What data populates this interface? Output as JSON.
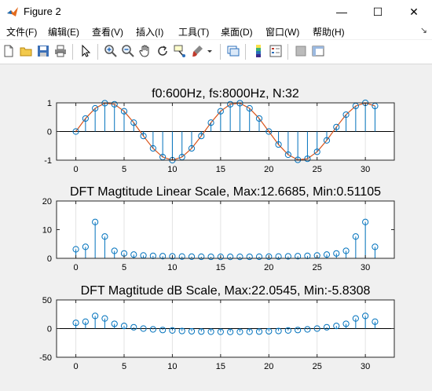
{
  "window": {
    "title": "Figure 2",
    "minimize_glyph": "—",
    "maximize_glyph": "☐",
    "close_glyph": "✕"
  },
  "menu": {
    "items": [
      "文件(F)",
      "编辑(E)",
      "查看(V)",
      "插入(I)",
      "工具(T)",
      "桌面(D)",
      "窗口(W)",
      "帮助(H)"
    ],
    "overflow_glyph": "↘"
  },
  "toolbar": {
    "icons": [
      "new-figure-icon",
      "open-file-icon",
      "save-icon",
      "print-icon",
      "pointer-icon",
      "zoom-in-icon",
      "zoom-out-icon",
      "pan-icon",
      "rotate-3d-icon",
      "data-cursor-icon",
      "brush-icon",
      "link-plot-icon",
      "colorbar-icon",
      "legend-icon",
      "hide-plot-tools-icon",
      "show-plot-tools-icon"
    ]
  },
  "colors": {
    "stem": "#0072BD",
    "line": "#D95319",
    "axes_bg": "#ffffff",
    "figure_bg": "#f0f0f0"
  },
  "chart_data": [
    {
      "type": "stem",
      "title": "f0:600Hz, fs:8000Hz, N:32",
      "xlim": [
        -2,
        33
      ],
      "ylim": [
        -1,
        1
      ],
      "xticks": [
        0,
        5,
        10,
        15,
        20,
        25,
        30
      ],
      "yticks": [
        -1,
        0,
        1
      ],
      "grid": "x",
      "zero_line": true,
      "x": [
        0,
        1,
        2,
        3,
        4,
        5,
        6,
        7,
        8,
        9,
        10,
        11,
        12,
        13,
        14,
        15,
        16,
        17,
        18,
        19,
        20,
        21,
        22,
        23,
        24,
        25,
        26,
        27,
        28,
        29,
        30,
        31
      ],
      "series": [
        {
          "kind": "stem",
          "color": "#0072BD",
          "values": [
            0,
            0.454,
            0.809,
            0.988,
            0.951,
            0.707,
            0.309,
            -0.156,
            -0.588,
            -0.891,
            -1.0,
            -0.891,
            -0.588,
            -0.156,
            0.309,
            0.707,
            0.951,
            0.988,
            0.809,
            0.454,
            0,
            -0.454,
            -0.809,
            -0.988,
            -0.951,
            -0.707,
            -0.309,
            0.156,
            0.588,
            0.891,
            1.0,
            0.891
          ]
        },
        {
          "kind": "line",
          "color": "#D95319",
          "values": [
            0,
            0.454,
            0.809,
            0.988,
            0.951,
            0.707,
            0.309,
            -0.156,
            -0.588,
            -0.891,
            -1.0,
            -0.891,
            -0.588,
            -0.156,
            0.309,
            0.707,
            0.951,
            0.988,
            0.809,
            0.454,
            0,
            -0.454,
            -0.809,
            -0.988,
            -0.951,
            -0.707,
            -0.309,
            0.156,
            0.588,
            0.891,
            1.0,
            0.891
          ]
        }
      ]
    },
    {
      "type": "stem",
      "title": "DFT Magtitude Linear Scale,  Max:12.6685, Min:0.51105",
      "xlim": [
        -2,
        33
      ],
      "ylim": [
        0,
        20
      ],
      "xticks": [
        0,
        5,
        10,
        15,
        20,
        25,
        30
      ],
      "yticks": [
        0,
        10,
        20
      ],
      "grid": "x",
      "zero_line": false,
      "x": [
        0,
        1,
        2,
        3,
        4,
        5,
        6,
        7,
        8,
        9,
        10,
        11,
        12,
        13,
        14,
        15,
        16,
        17,
        18,
        19,
        20,
        21,
        22,
        23,
        24,
        25,
        26,
        27,
        28,
        29,
        30,
        31
      ],
      "series": [
        {
          "kind": "stem",
          "color": "#0072BD",
          "values": [
            3.15,
            4.0,
            12.6685,
            7.6,
            2.6,
            1.7,
            1.3,
            1.0,
            0.85,
            0.75,
            0.68,
            0.62,
            0.58,
            0.55,
            0.53,
            0.52,
            0.51105,
            0.52,
            0.53,
            0.55,
            0.58,
            0.62,
            0.68,
            0.75,
            0.85,
            1.0,
            1.3,
            1.7,
            2.6,
            7.6,
            12.6685,
            4.0
          ]
        }
      ]
    },
    {
      "type": "stem",
      "title": "DFT Magtitude dB Scale,  Max:22.0545, Min:-5.8308",
      "xlim": [
        -2,
        33
      ],
      "ylim": [
        -50,
        50
      ],
      "xticks": [
        0,
        5,
        10,
        15,
        20,
        25,
        30
      ],
      "yticks": [
        -50,
        0,
        50
      ],
      "grid": "x",
      "zero_line": true,
      "x": [
        0,
        1,
        2,
        3,
        4,
        5,
        6,
        7,
        8,
        9,
        10,
        11,
        12,
        13,
        14,
        15,
        16,
        17,
        18,
        19,
        20,
        21,
        22,
        23,
        24,
        25,
        26,
        27,
        28,
        29,
        30,
        31
      ],
      "series": [
        {
          "kind": "stem",
          "color": "#0072BD",
          "values": [
            10.0,
            12.0,
            22.0545,
            17.6,
            8.3,
            4.6,
            2.3,
            0.0,
            -1.4,
            -2.5,
            -3.3,
            -4.2,
            -4.7,
            -5.2,
            -5.5,
            -5.7,
            -5.8308,
            -5.7,
            -5.5,
            -5.2,
            -4.7,
            -4.2,
            -3.3,
            -2.5,
            -1.4,
            0.0,
            2.3,
            4.6,
            8.3,
            17.6,
            22.0545,
            12.0
          ]
        }
      ]
    }
  ]
}
